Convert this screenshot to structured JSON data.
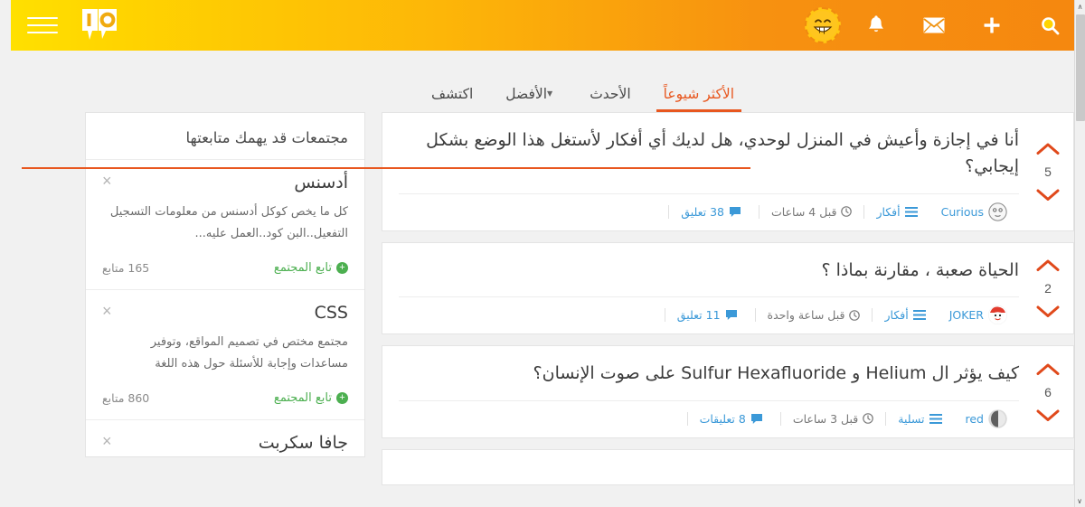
{
  "header": {
    "avatar_icon": "grinning-face-avatar",
    "icons": [
      {
        "name": "bell-icon",
        "label": "الإشعارات"
      },
      {
        "name": "envelope-icon",
        "label": "الرسائل"
      },
      {
        "name": "plus-icon",
        "label": "إضافة"
      },
      {
        "name": "search-icon",
        "label": "بحث"
      }
    ],
    "logo_name": "io-speech-bubble-logo",
    "menu_icon": "hamburger-menu-icon",
    "gradient_start": "#FFE000",
    "gradient_end": "#F5870F"
  },
  "tabs": [
    {
      "label": "الأكثر شيوعاً",
      "active": true,
      "has_caret": false
    },
    {
      "label": "الأحدث",
      "active": false,
      "has_caret": false
    },
    {
      "label": "الأفضل",
      "active": false,
      "has_caret": true
    },
    {
      "label": "اكتشف",
      "active": false,
      "has_caret": false
    }
  ],
  "accent_color": "#e8571f",
  "link_color": "#3b99d8",
  "follow_color": "#4CAF50",
  "posts": [
    {
      "title": "أنا في إجازة وأعيش في المنزل لوحدي، هل لديك أي أفكار لأستغل هذا الوضع بشكل إيجابي؟",
      "votes": "5",
      "author": "Curious",
      "avatar_icon": "curious-face-avatar",
      "category": "أفكار",
      "time": "قبل 4 ساعات",
      "comments": "38 تعليق"
    },
    {
      "title": "الحياة صعبة ، مقارنة بماذا ؟",
      "votes": "2",
      "author": "JOKER",
      "avatar_icon": "joker-face-avatar",
      "category": "أفكار",
      "time": "قبل ساعة واحدة",
      "comments": "11 تعليق"
    },
    {
      "title": "كيف يؤثر ال Helium و Sulfur Hexafluoride على صوت الإنسان؟",
      "votes": "6",
      "author": "red",
      "avatar_icon": "red-photo-avatar",
      "category": "تسلية",
      "time": "قبل 3 ساعات",
      "comments": "8 تعليقات"
    }
  ],
  "sidebar": {
    "title": "مجتمعات قد يهمك متابعتها",
    "follow_label": "تابع المجتمع",
    "close_glyph": "×",
    "communities": [
      {
        "name": "أدسنس",
        "description": "كل ما يخص كوكل أدسنس من معلومات التسجيل التفعيل..البن كود..العمل عليه...",
        "followers": "165 متابع"
      },
      {
        "name": "CSS",
        "description": "مجتمع مختص في تصميم المواقع، وتوفير مساعدات وإجابة للأسئلة حول هذه اللغة",
        "followers": "860 متابع"
      },
      {
        "name": "جافا سكربت",
        "description": "",
        "followers": ""
      }
    ]
  },
  "scrollbar": {
    "up_glyph": "∧",
    "down_glyph": "∨"
  }
}
